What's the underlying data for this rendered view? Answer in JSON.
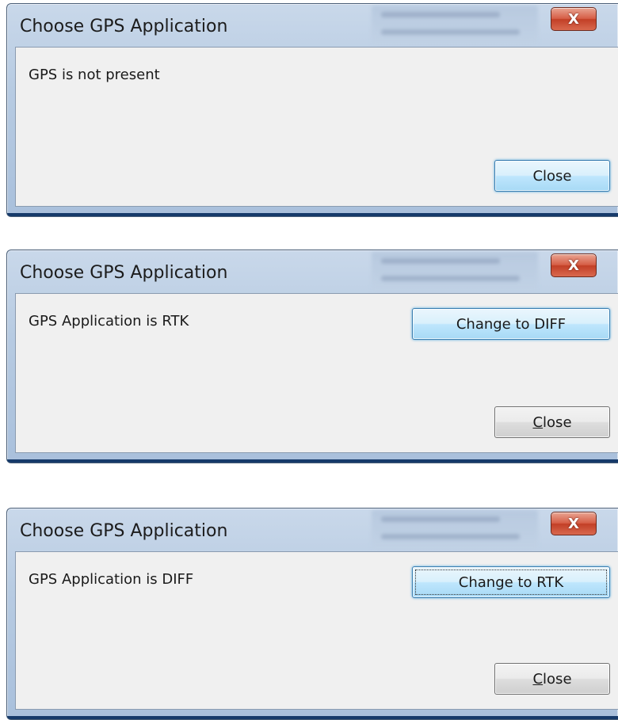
{
  "dialogs": [
    {
      "title": "Choose GPS Application",
      "close_glyph": "X",
      "message": "GPS is not present",
      "close_button": "Close"
    },
    {
      "title": "Choose GPS Application",
      "close_glyph": "X",
      "message": "GPS Application is RTK",
      "change_button": "Change to DIFF",
      "close_button_mnemonic": "C",
      "close_button_rest": "lose"
    },
    {
      "title": "Choose GPS Application",
      "close_glyph": "X",
      "message": "GPS Application is DIFF",
      "change_button": "Change to RTK",
      "close_button_mnemonic": "C",
      "close_button_rest": "lose"
    }
  ],
  "colors": {
    "close_x_button": "#c9452c",
    "focus_button": "#bee6fd",
    "window_frame": "#b7cbe2"
  }
}
